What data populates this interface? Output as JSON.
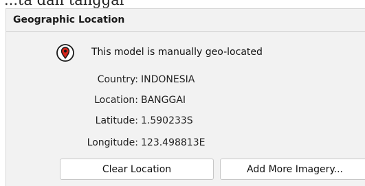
{
  "background_caption": "...ta dan tanggal",
  "panel": {
    "title": "Geographic Location",
    "status_icon": "map-pin-icon",
    "status_text": "This model is manually geo-located"
  },
  "fields": {
    "country": {
      "label": "Country:",
      "value": "INDONESIA"
    },
    "location": {
      "label": "Location:",
      "value": "BANGGAI"
    },
    "latitude": {
      "label": "Latitude:",
      "value": "1.590233S"
    },
    "longitude": {
      "label": "Longitude:",
      "value": "123.498813E"
    }
  },
  "buttons": {
    "clear_label": "Clear Location",
    "imagery_label": "Add More Imagery..."
  },
  "colors": {
    "panel_background": "#f2f2f2",
    "pin_red": "#d6261d",
    "pin_outline": "#1a1a1a"
  }
}
